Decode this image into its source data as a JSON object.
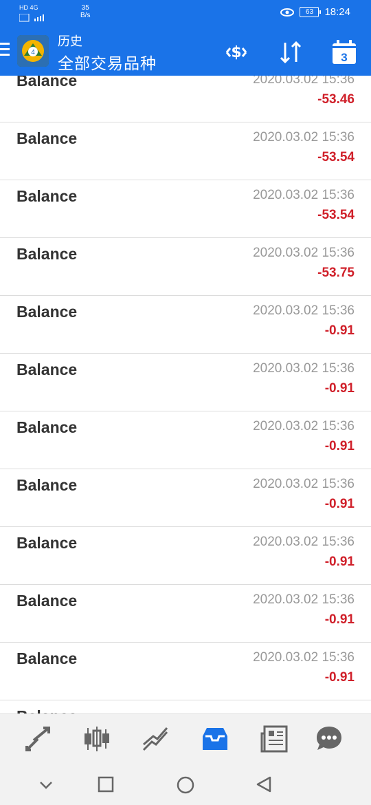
{
  "status": {
    "signal_left": "HD 4G",
    "net_speed_value": "35",
    "net_speed_unit": "B/s",
    "battery": "63",
    "time": "18:24"
  },
  "header": {
    "title": "历史",
    "subtitle": "全部交易品种",
    "calendar_day": "3"
  },
  "rows": [
    {
      "name": "Balance",
      "time": "2020.03.02 15:36",
      "profit": "-53.46"
    },
    {
      "name": "Balance",
      "time": "2020.03.02 15:36",
      "profit": "-53.54"
    },
    {
      "name": "Balance",
      "time": "2020.03.02 15:36",
      "profit": "-53.54"
    },
    {
      "name": "Balance",
      "time": "2020.03.02 15:36",
      "profit": "-53.75"
    },
    {
      "name": "Balance",
      "time": "2020.03.02 15:36",
      "profit": "-0.91"
    },
    {
      "name": "Balance",
      "time": "2020.03.02 15:36",
      "profit": "-0.91"
    },
    {
      "name": "Balance",
      "time": "2020.03.02 15:36",
      "profit": "-0.91"
    },
    {
      "name": "Balance",
      "time": "2020.03.02 15:36",
      "profit": "-0.91"
    },
    {
      "name": "Balance",
      "time": "2020.03.02 15:36",
      "profit": "-0.91"
    },
    {
      "name": "Balance",
      "time": "2020.03.02 15:36",
      "profit": "-0.91"
    },
    {
      "name": "Balance",
      "time": "2020.03.02 15:36",
      "profit": "-0.91"
    },
    {
      "name": "Balance",
      "time": "",
      "profit": ""
    }
  ],
  "bottom_nav": [
    "trade-icon",
    "quotes-candles-icon",
    "chart-icon",
    "history-inbox-icon",
    "news-icon",
    "chat-icon"
  ],
  "colors": {
    "primary": "#1a73e8",
    "loss": "#d0202a",
    "active_tab": "#1a73e8",
    "inactive_tab": "#666666"
  }
}
